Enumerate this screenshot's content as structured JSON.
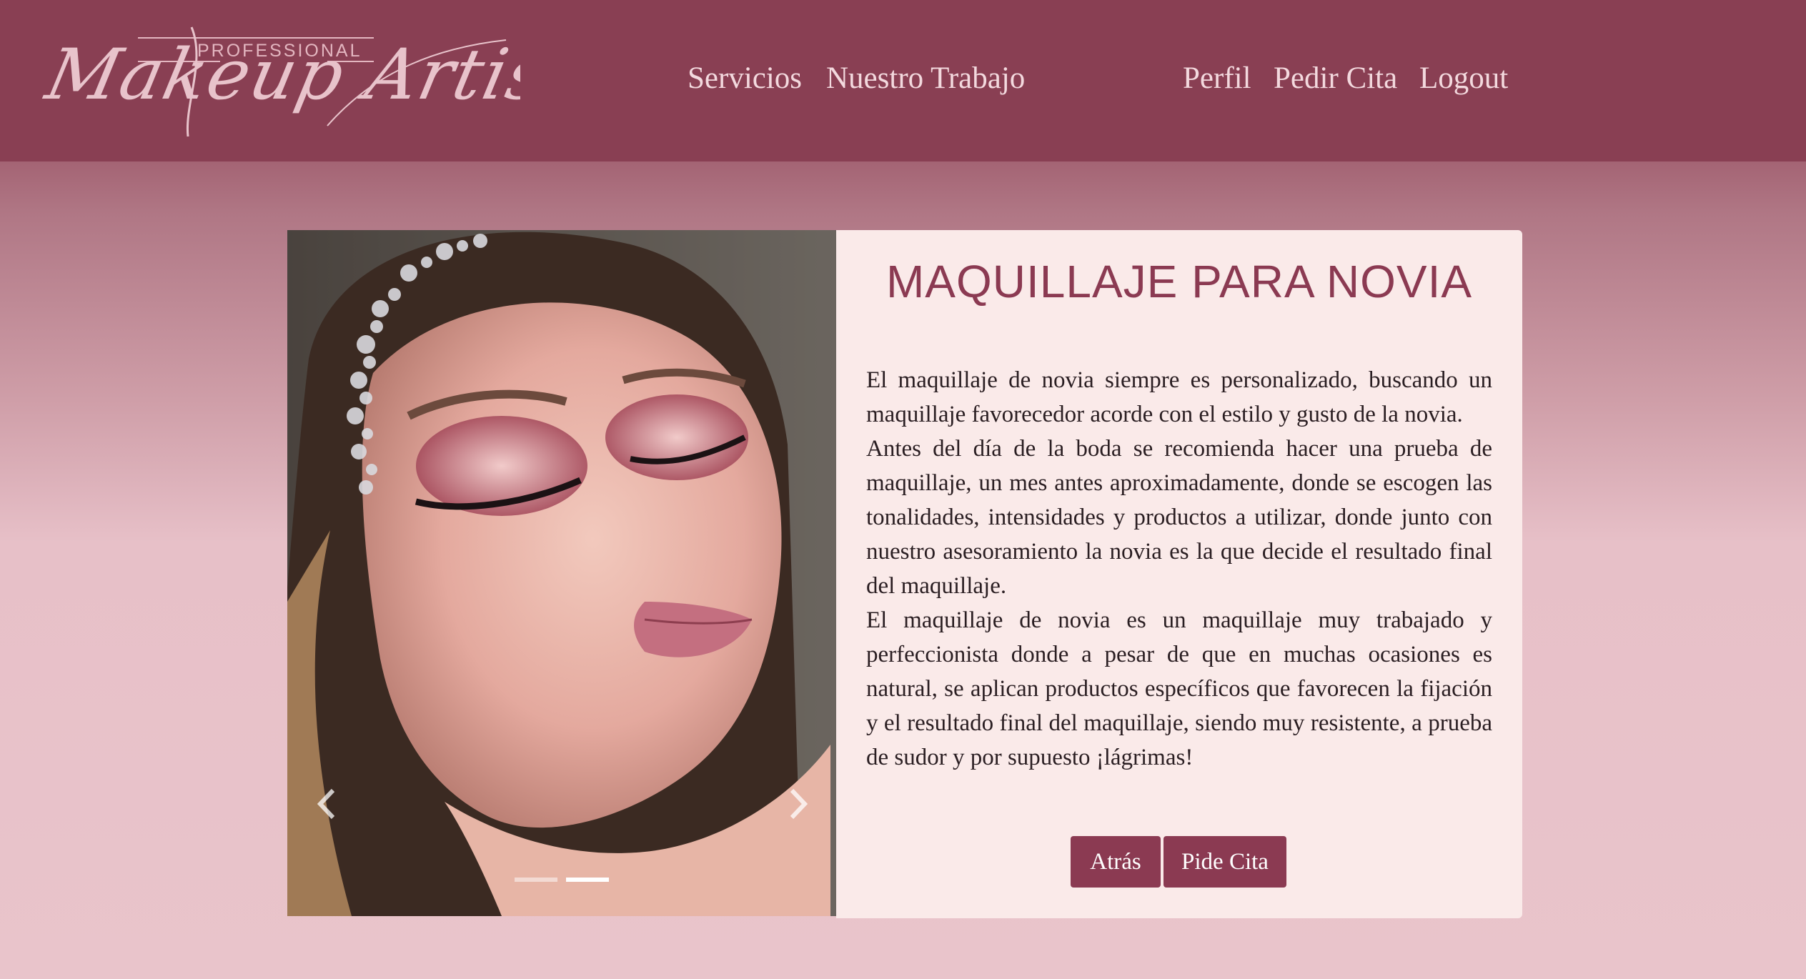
{
  "header": {
    "logo": {
      "top_text": "PROFESSIONAL",
      "script_text": "Makeup Artist"
    },
    "nav_left": [
      "Servicios",
      "Nuestro Trabajo"
    ],
    "nav_right": [
      "Perfil",
      "Pedir Cita",
      "Logout"
    ]
  },
  "carousel": {
    "slides_count": 2,
    "active_slide": 2,
    "prev_icon": "chevron-left-icon",
    "next_icon": "chevron-right-icon"
  },
  "service": {
    "title": "MAQUILLAJE PARA NOVIA",
    "paragraphs": [
      "El maquillaje de novia siempre es personalizado, buscando un maquillaje favorecedor acorde con el estilo y gusto de la novia.",
      "Antes del día de la boda se recomienda hacer una prueba de maquillaje, un mes antes aproximadamente, donde se escogen las tonalidades, intensidades y productos a utilizar, donde junto con nuestro asesoramiento la novia es la que decide el resultado final del maquillaje.",
      "El maquillaje de novia es un maquillaje muy trabajado y perfeccionista donde a pesar de que en muchas ocasiones es natural, se aplican productos específicos que favorecen la fijación y el resultado final del maquillaje, siendo muy resistente, a prueba de sudor y por supuesto ¡lágrimas!"
    ],
    "buttons": {
      "back": "Atrás",
      "book": "Pide Cita"
    }
  },
  "colors": {
    "navbar": "#893f53",
    "accent": "#8b3a52",
    "card": "#faeae9",
    "nav_text": "#f3d9de"
  }
}
